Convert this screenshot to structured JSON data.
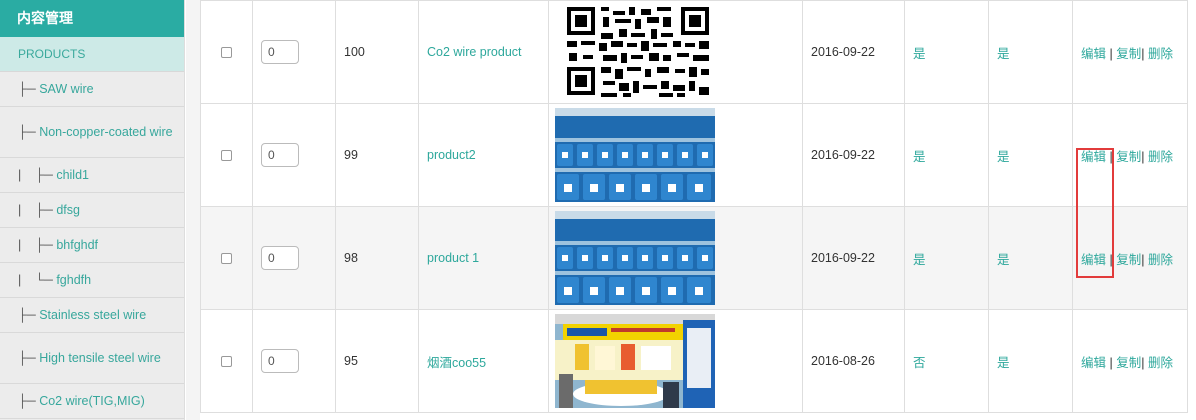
{
  "sidebar": {
    "header": "内容管理",
    "category": "PRODUCTS",
    "items": [
      {
        "prefix": "├─ ",
        "label": "SAW wire"
      },
      {
        "prefix": "├─ ",
        "label": "Non-copper-coated wire"
      },
      {
        "prefix": "|    ├─ ",
        "label": "child1"
      },
      {
        "prefix": "|    ├─ ",
        "label": "dfsg"
      },
      {
        "prefix": "|    ├─ ",
        "label": "bhfghdf"
      },
      {
        "prefix": "|    └─ ",
        "label": "fghdfh"
      },
      {
        "prefix": "├─ ",
        "label": "Stainless steel wire"
      },
      {
        "prefix": "├─ ",
        "label": "High tensile steel wire"
      },
      {
        "prefix": "├─ ",
        "label": "Co2 wire(TIG,MIG)"
      }
    ]
  },
  "rows": [
    {
      "sort": "0",
      "id": "100",
      "title": "Co2 wire product",
      "image": "qr-code",
      "date": "2016-09-22",
      "col_a": "是",
      "col_b": "是",
      "edit": "编辑",
      "copy": "复制",
      "delete": "删除"
    },
    {
      "sort": "0",
      "id": "99",
      "title": "product2",
      "image": "blue-drums-photo",
      "date": "2016-09-22",
      "col_a": "是",
      "col_b": "是",
      "edit": "编辑",
      "copy": "复制",
      "delete": "删除"
    },
    {
      "sort": "0",
      "id": "98",
      "title": "product 1",
      "image": "blue-drums-photo",
      "date": "2016-09-22",
      "col_a": "是",
      "col_b": "是",
      "edit": "编辑",
      "copy": "复制",
      "delete": "删除"
    },
    {
      "sort": "0",
      "id": "95",
      "title": "烟酒coo55",
      "image": "exhibition-booth-photo",
      "date": "2016-08-26",
      "col_a": "否",
      "col_b": "是",
      "edit": "编辑",
      "copy": "复制",
      "delete": "删除"
    }
  ],
  "colors": {
    "accent": "#2aaca3",
    "link": "#2ea89c",
    "highlight": "#e23b3b"
  }
}
